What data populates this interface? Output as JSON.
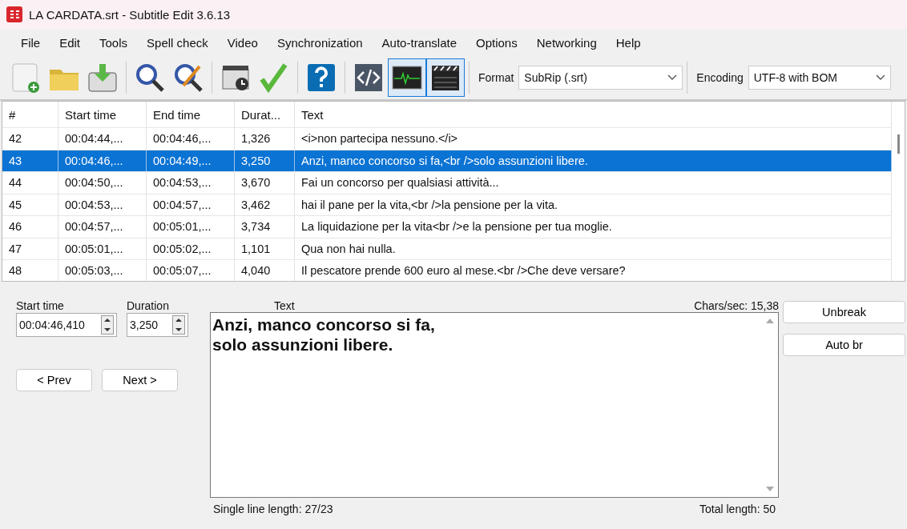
{
  "window": {
    "title": "LA CARDATA.srt - Subtitle Edit 3.6.13"
  },
  "menu": [
    "File",
    "Edit",
    "Tools",
    "Spell check",
    "Video",
    "Synchronization",
    "Auto-translate",
    "Options",
    "Networking",
    "Help"
  ],
  "toolbar": {
    "groups": [
      [
        {
          "pressed": false
        },
        {
          "pressed": false
        },
        {
          "pressed": false
        }
      ],
      [
        {
          "pressed": false
        },
        {
          "pressed": false
        }
      ],
      [
        {
          "pressed": false
        },
        {
          "pressed": false
        }
      ],
      [
        {
          "pressed": false
        }
      ],
      [
        {
          "pressed": false
        },
        {
          "pressed": true
        },
        {
          "pressed": true
        }
      ]
    ],
    "format": {
      "label": "Format",
      "value": "SubRip (.srt)"
    },
    "encoding": {
      "label": "Encoding",
      "value": "UTF-8 with BOM"
    }
  },
  "table": {
    "columns": [
      "#",
      "Start time",
      "End time",
      "Durat...",
      "Text"
    ],
    "rows": [
      {
        "cells": [
          "42",
          "00:04:44,...",
          "00:04:46,...",
          "1,326",
          "<i>non partecipa nessuno.</i>"
        ],
        "selected": false
      },
      {
        "cells": [
          "43",
          "00:04:46,...",
          "00:04:49,...",
          "3,250",
          "Anzi, manco concorso si fa,<br />solo assunzioni libere."
        ],
        "selected": true
      },
      {
        "cells": [
          "44",
          "00:04:50,...",
          "00:04:53,...",
          "3,670",
          "Fai un concorso per qualsiasi attività..."
        ],
        "selected": false
      },
      {
        "cells": [
          "45",
          "00:04:53,...",
          "00:04:57,...",
          "3,462",
          "hai il pane per la vita,<br />la pensione per la vita."
        ],
        "selected": false
      },
      {
        "cells": [
          "46",
          "00:04:57,...",
          "00:05:01,...",
          "3,734",
          "La liquidazione per la vita<br />e la pensione per tua moglie."
        ],
        "selected": false
      },
      {
        "cells": [
          "47",
          "00:05:01,...",
          "00:05:02,...",
          "1,101",
          "Qua non hai nulla."
        ],
        "selected": false
      },
      {
        "cells": [
          "48",
          "00:05:03,...",
          "00:05:07,...",
          "4,040",
          "Il pescatore prende 600 euro al mese.<br />Che deve versare?"
        ],
        "selected": false
      }
    ]
  },
  "editor": {
    "start_time": {
      "label": "Start time",
      "value": "00:04:46,410"
    },
    "duration": {
      "label": "Duration",
      "value": "3,250"
    },
    "buttons": [
      "< Prev",
      "Next >"
    ],
    "text": {
      "label": "Text",
      "lines": [
        "Anzi, manco concorso si fa,",
        "solo assunzioni libere."
      ]
    },
    "chars_per_sec": "Chars/sec: 15,38",
    "single_line_length": "Single line length: 27/23",
    "total_length": "Total length: 50",
    "side_buttons": [
      "Unbreak",
      "Auto br"
    ]
  }
}
